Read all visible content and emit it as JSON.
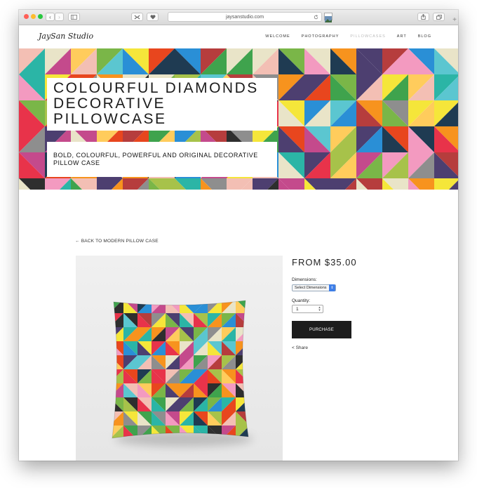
{
  "browser": {
    "url": "jaysanstudio.com",
    "back_glyph": "‹",
    "forward_glyph": "›",
    "new_tab_glyph": "+",
    "traffic_lights": [
      "#ff5f57",
      "#febc2e",
      "#28c840"
    ],
    "icons": [
      "back-icon",
      "forward-icon",
      "sidebar-icon",
      "extensions-icon",
      "pocket-icon",
      "reload-icon",
      "share-icon",
      "tabs-icon",
      "new-tab-icon"
    ]
  },
  "site": {
    "logo": "JaySan Studio",
    "nav": [
      {
        "label": "WELCOME",
        "active": false
      },
      {
        "label": "PHOTOGRAPHY",
        "active": false
      },
      {
        "label": "PILLOWCASES",
        "active": true
      },
      {
        "label": "ART",
        "active": false
      },
      {
        "label": "BLOG",
        "active": false
      }
    ]
  },
  "hero": {
    "title_line1": "COLOURFUL DIAMONDS",
    "title_line2": "DECORATIVE",
    "title_line3": "PILLOWCASE",
    "subtitle": "BOLD, COLOURFUL, POWERFUL AND ORIGINAL DECORATIVE PILLOW CASE",
    "palette": [
      "#e8334a",
      "#f5e63a",
      "#2bb5a6",
      "#1f3b52",
      "#f39ac0",
      "#7ab648",
      "#f7931e",
      "#4d3f70",
      "#e9e4c8",
      "#2a8fd6",
      "#c44a8c",
      "#f3bfb4",
      "#8e8e8e",
      "#e8461e",
      "#a7c24a",
      "#5bc6d0",
      "#2e2e2e",
      "#ffcc5c",
      "#b63d3d",
      "#3fa34d"
    ]
  },
  "product": {
    "back_link": "← BACK TO MODERN PILLOW CASE",
    "price": "FROM $35.00",
    "dimensions_label": "Dimensions:",
    "dimensions_selected": "Select Dimensions",
    "quantity_label": "Quantity:",
    "quantity_value": "1",
    "purchase_label": "PURCHASE",
    "share_label": "< Share"
  }
}
